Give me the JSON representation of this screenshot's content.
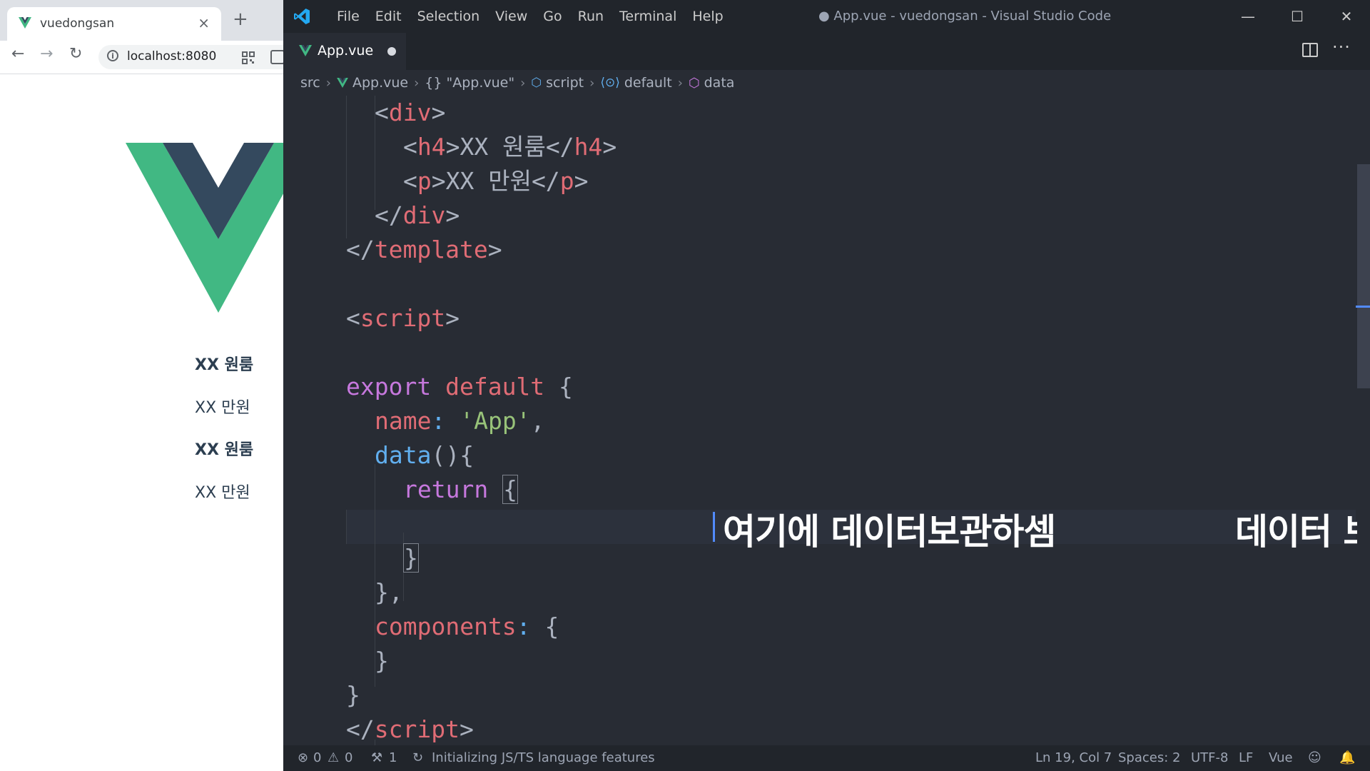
{
  "browser": {
    "tab_title": "vuedongsan",
    "tab_close": "×",
    "new_tab": "+",
    "back": "←",
    "forward": "→",
    "reload": "↻",
    "url": "localhost:8080",
    "products": [
      {
        "title": "XX 원룸",
        "price": "XX 만원"
      },
      {
        "title": "XX 원룸",
        "price": "XX 만원"
      }
    ],
    "colors": {
      "vue_green": "#41b883",
      "vue_navy": "#34495e"
    }
  },
  "vscode": {
    "window_title": "● App.vue - vuedongsan - Visual Studio Code",
    "menu": [
      "File",
      "Edit",
      "Selection",
      "View",
      "Go",
      "Run",
      "Terminal",
      "Help"
    ],
    "window_controls": {
      "minimize": "—",
      "maximize": "☐",
      "close": "✕"
    },
    "tab": {
      "label": "App.vue",
      "dirty": true
    },
    "breadcrumbs": {
      "src": "src",
      "file": "App.vue",
      "block": "\"App.vue\"",
      "block_icon": "{}",
      "script": "script",
      "default": "default",
      "data": "data"
    },
    "code": {
      "l1_open": "<",
      "l1_tag": "div",
      "l1_close": ">",
      "l2_open": "<",
      "l2_tag": "h4",
      "l2_mid": ">XX 원룸</",
      "l2_tag2": "h4",
      "l2_close": ">",
      "l3_open": "<",
      "l3_tag": "p",
      "l3_mid": ">XX 만원</",
      "l3_tag2": "p",
      "l3_close": ">",
      "l4_open": "</",
      "l4_tag": "div",
      "l4_close": ">",
      "l5_open": "</",
      "l5_tag": "template",
      "l5_close": ">",
      "l6_open": "<",
      "l6_tag": "script",
      "l6_close": ">",
      "l7_kw1": "export",
      "l7_kw2": "default",
      "l7_brace": "{",
      "l8_key": "name",
      "l8_colon": ":",
      "l8_str": "'App'",
      "l8_comma": ",",
      "l9_fn": "data",
      "l9_rest": "(){",
      "l10_kw": "return",
      "l10_brace": "{",
      "l12_brace": "}",
      "l13": "},",
      "l14_key": "components",
      "l14_colon": ":",
      "l14_brace": "{",
      "l15": "}",
      "l16": "}",
      "l17_open": "</",
      "l17_tag": "script",
      "l17_close": ">"
    },
    "overlay_left": "여기에 데이터보관하셈",
    "overlay_right": "데이터 보관함부터 있어야됨",
    "status": {
      "errors": "0",
      "warnings": "0",
      "tools": "1",
      "message": "Initializing JS/TS language features",
      "position": "Ln 19, Col 7",
      "spaces": "Spaces: 2",
      "encoding": "UTF-8",
      "eol": "LF",
      "language": "Vue"
    },
    "colors": {
      "keyword": "#c678dd",
      "tag": "#e06c75",
      "string": "#98c379",
      "function": "#61afef",
      "text": "#abb2bf",
      "bg": "#282c34",
      "chrome": "#21252b"
    }
  }
}
